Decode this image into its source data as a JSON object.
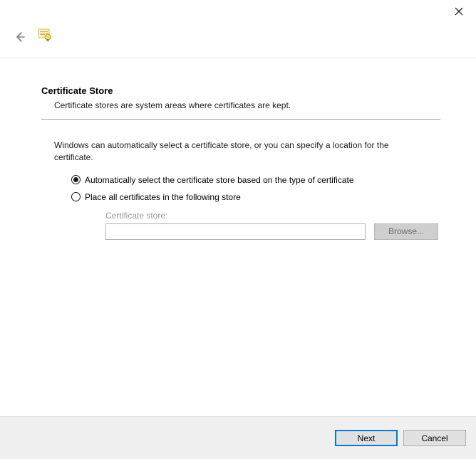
{
  "header": {
    "title": "Certificate Store",
    "subtitle": "Certificate stores are system areas where certificates are kept."
  },
  "body": {
    "intro": "Windows can automatically select a certificate store, or you can specify a location for the certificate.",
    "radios": {
      "auto": {
        "label": "Automatically select the certificate store based on the type of certificate",
        "selected": true
      },
      "place": {
        "label": "Place all certificates in the following store",
        "selected": false
      }
    },
    "store": {
      "label": "Certificate store:",
      "value": "",
      "browse_label": "Browse..."
    }
  },
  "footer": {
    "next_label": "Next",
    "cancel_label": "Cancel"
  }
}
